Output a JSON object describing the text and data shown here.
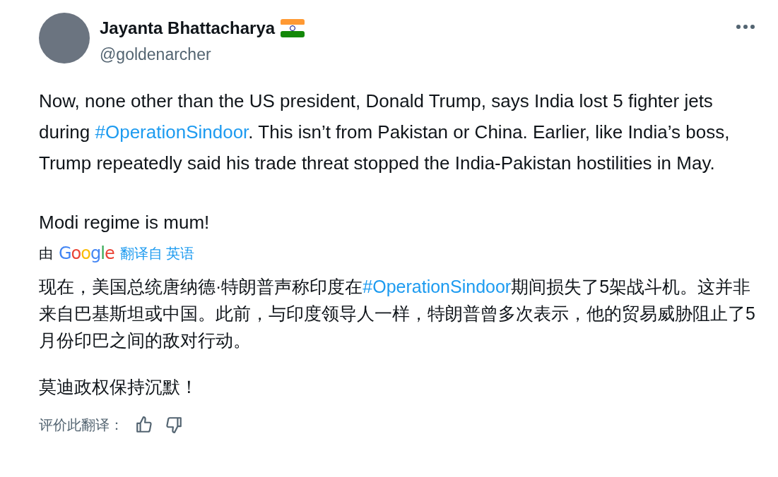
{
  "author": {
    "name": "Jayanta Bhattacharya",
    "handle": "@goldenarcher"
  },
  "original_text": [
    {
      "segments": [
        {
          "kind": "text",
          "text": "Now, none other than the US president, Donald Trump, says India lost 5 fighter jets during "
        },
        {
          "kind": "hashtag",
          "text": "#OperationSindoor"
        },
        {
          "kind": "text",
          "text": ". This isn’t from Pakistan or China. Earlier, like India’s boss, Trump repeatedly said his trade threat stopped the India-Pakistan hostilities in May."
        }
      ]
    },
    {
      "segments": [
        {
          "kind": "text",
          "text": "Modi regime is mum!"
        }
      ]
    }
  ],
  "translation_note": {
    "prefix": "由",
    "logo": "Google",
    "link": "翻译自 英语"
  },
  "translated_text": [
    {
      "segments": [
        {
          "kind": "text",
          "text": "现在，美国总统唐纳德·特朗普声称印度在"
        },
        {
          "kind": "hashtag",
          "text": "#OperationSindoor"
        },
        {
          "kind": "text",
          "text": "期间损失了5架战斗机。这并非来自巴基斯坦或中国。此前，与印度领导人一样，特朗普曾多次表示，他的贸易威胁阻止了5月份印巴之间的敌对行动。"
        }
      ]
    },
    {
      "segments": [
        {
          "kind": "text",
          "text": "莫迪政权保持沉默！"
        }
      ]
    }
  ],
  "rate_translation": {
    "label": "评价此翻译："
  }
}
